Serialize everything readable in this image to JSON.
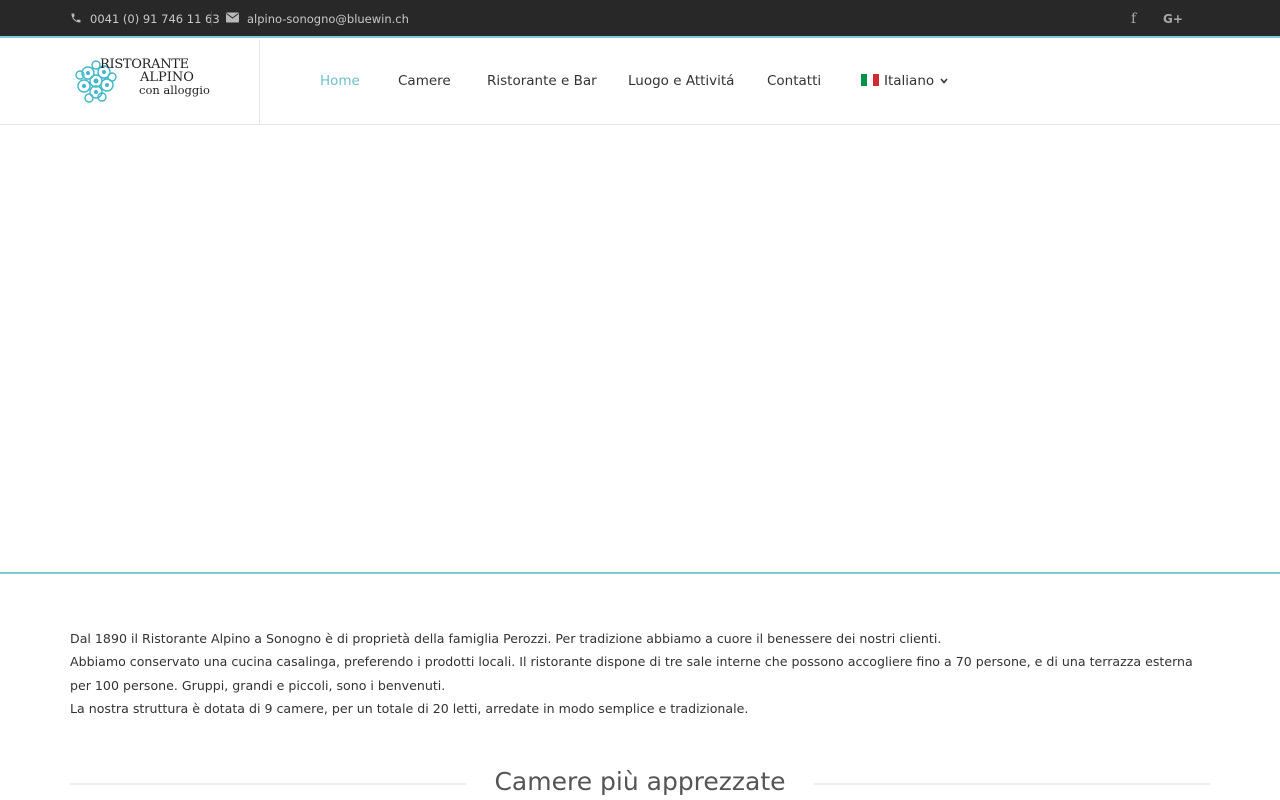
{
  "topbar": {
    "phone": "0041 (0) 91 746 11 63",
    "email": "alpino-sonogno@bluewin.ch",
    "phone_icon": "phone-icon",
    "email_icon": "envelope-icon",
    "social": [
      {
        "icon": "facebook-icon",
        "glyph": "f"
      },
      {
        "icon": "google-plus-icon",
        "glyph": "G+"
      }
    ]
  },
  "logo": {
    "line1": "Ristorante",
    "line2": "Alpino",
    "line3": "con alloggio"
  },
  "nav": {
    "items": [
      "Home",
      "Camere",
      "Ristorante e Bar",
      "Luogo e Attivitá",
      "Contatti"
    ],
    "active_index": 0,
    "language": "Italiano",
    "language_icon": "italy-flag-icon"
  },
  "intro": {
    "paragraphs": [
      "Dal 1890 il Ristorante Alpino a Sonogno è di proprietà della famiglia Perozzi. Per tradizione abbiamo a cuore il benessere dei nostri clienti.",
      "Abbiamo conservato una cucina casalinga, preferendo i prodotti locali. Il ristorante dispone di tre sale interne che possono accogliere fino a 70 persone, e di una terrazza esterna per 100 persone. Gruppi, grandi e piccoli, sono i benvenuti.",
      "La nostra struttura è dotata di 9 camere, per un totale di 20 letti, arredate in modo semplice e tradizionale."
    ]
  },
  "section": {
    "title": "Camere più apprezzate"
  },
  "colors": {
    "accent": "#6fbfc8",
    "topbar_bg": "#282828",
    "logo_flower": "#3fb8c8"
  }
}
